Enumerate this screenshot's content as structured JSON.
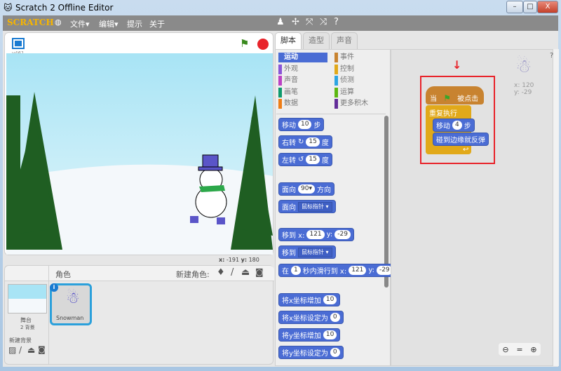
{
  "window": {
    "title": "Scratch 2 Offline Editor",
    "minimize": "–",
    "maximize": "□",
    "close": "X"
  },
  "menubar": {
    "logo": "SCRATCH",
    "file": "文件▾",
    "edit": "编辑▾",
    "tips": "提示",
    "about": "关于"
  },
  "stage": {
    "version": "v461",
    "coords_x_label": "x:",
    "coords_x": "-191",
    "coords_y_label": "y:",
    "coords_y": "180"
  },
  "tabs": [
    "脚本",
    "造型",
    "声音"
  ],
  "categories": [
    {
      "label": "运动",
      "color": "#4a6cd4"
    },
    {
      "label": "事件",
      "color": "#c88330"
    },
    {
      "label": "外观",
      "color": "#8a55d7"
    },
    {
      "label": "控制",
      "color": "#e1a91a"
    },
    {
      "label": "声音",
      "color": "#bb42c3"
    },
    {
      "label": "侦测",
      "color": "#2ca5e2"
    },
    {
      "label": "画笔",
      "color": "#0e9a6c"
    },
    {
      "label": "运算",
      "color": "#5cb712"
    },
    {
      "label": "数据",
      "color": "#ee7d16"
    },
    {
      "label": "更多积木",
      "color": "#632d99"
    }
  ],
  "blocks": [
    [
      {
        "t": "移动"
      },
      {
        "i": "10"
      },
      {
        "t": "步"
      }
    ],
    [
      {
        "t": "右转"
      },
      {
        "t": "↻"
      },
      {
        "i": "15"
      },
      {
        "t": "度"
      }
    ],
    [
      {
        "t": "左转"
      },
      {
        "t": "↺"
      },
      {
        "i": "15"
      },
      {
        "t": "度"
      }
    ],
    [
      {
        "t": "面向"
      },
      {
        "i": "90▾"
      },
      {
        "t": "方向"
      }
    ],
    [
      {
        "t": "面向"
      },
      {
        "d": "鼠标指针 ▾"
      }
    ],
    [
      {
        "t": "移到 x:"
      },
      {
        "i": "121"
      },
      {
        "t": "y:"
      },
      {
        "i": "-29"
      }
    ],
    [
      {
        "t": "移到"
      },
      {
        "d": "鼠标指针 ▾"
      }
    ],
    [
      {
        "t": "在"
      },
      {
        "i": "1"
      },
      {
        "t": "秒内滑行到 x:"
      },
      {
        "i": "121"
      },
      {
        "t": "y:"
      },
      {
        "i": "-29"
      }
    ],
    [
      {
        "t": "将x坐标增加"
      },
      {
        "i": "10"
      }
    ],
    [
      {
        "t": "将x坐标设定为"
      },
      {
        "i": "0"
      }
    ],
    [
      {
        "t": "将y坐标增加"
      },
      {
        "i": "10"
      }
    ],
    [
      {
        "t": "将y坐标设定为"
      },
      {
        "i": "0"
      }
    ]
  ],
  "script": {
    "hat_when": "当",
    "hat_clicked": "被点击",
    "forever": "重复执行",
    "move": "移动",
    "move_steps": "4",
    "move_unit": "步",
    "bounce": "碰到边缘就反弹"
  },
  "sprite_info": {
    "x_label": "x:",
    "x": "120",
    "y_label": "y:",
    "y": "-29"
  },
  "sprites_panel": {
    "title": "角色",
    "new_sprite": "新建角色:",
    "stage_label": "舞台",
    "backdrops": "2 背景",
    "new_backdrop": "新建背景",
    "sprite_name": "Snowman"
  },
  "colors": {
    "highlight": "#e8232a",
    "motion": "#4a6cd4",
    "control": "#e1a91a",
    "events": "#c88330"
  }
}
